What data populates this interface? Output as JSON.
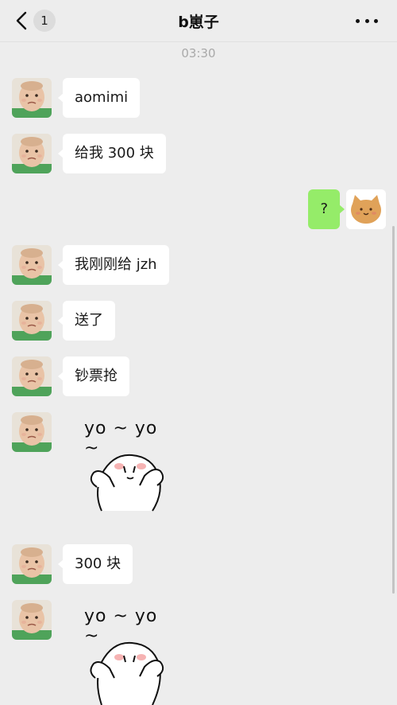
{
  "header": {
    "title": "b崽子",
    "unread_count": "1"
  },
  "timestamp": "03:30",
  "messages": [
    {
      "side": "left",
      "type": "text",
      "text": "aomimi"
    },
    {
      "side": "left",
      "type": "text",
      "text": "给我 300 块"
    },
    {
      "side": "right",
      "type": "text",
      "text": "?"
    },
    {
      "side": "left",
      "type": "text",
      "text": "我刚刚给 jzh"
    },
    {
      "side": "left",
      "type": "text",
      "text": "送了"
    },
    {
      "side": "left",
      "type": "text",
      "text": "钞票抢"
    },
    {
      "side": "left",
      "type": "sticker",
      "sticker_text": "yo ~ yo ~"
    },
    {
      "side": "left",
      "type": "text",
      "text": "300 块"
    },
    {
      "side": "left",
      "type": "sticker",
      "sticker_text": "yo ~ yo ~"
    }
  ],
  "colors": {
    "background": "#ededed",
    "bubble_incoming": "#ffffff",
    "bubble_outgoing": "#95ec69"
  },
  "icons": {
    "back": "chevron-left-icon",
    "more": "more-horizontal-icon",
    "avatar_incoming": "baby-photo-avatar",
    "avatar_outgoing": "cat-bun-avatar",
    "sticker": "blushing-bun-character"
  }
}
